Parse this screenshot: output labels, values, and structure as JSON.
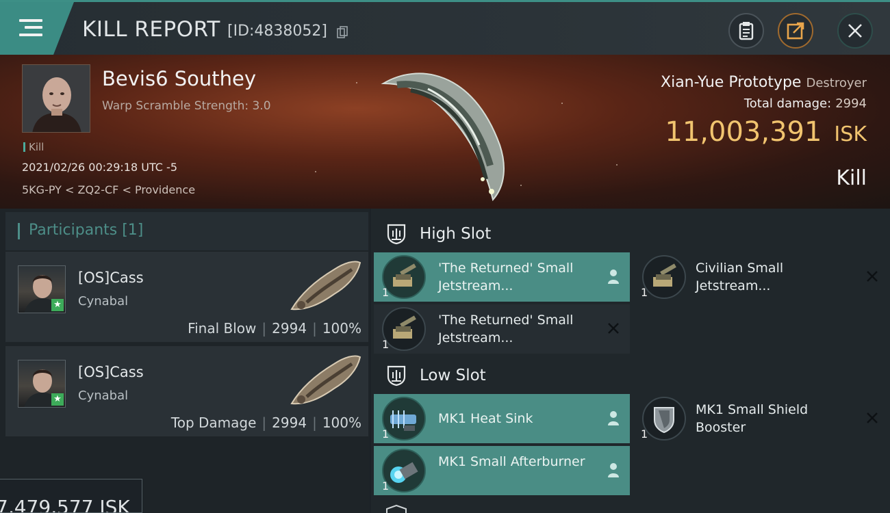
{
  "header": {
    "title": "KILL REPORT",
    "id": "[ID:4838052]",
    "colors": {
      "accent": "#3b8c84",
      "isk": "#f1c46f"
    }
  },
  "victim": {
    "name": "Bevis6 Southey",
    "subline": "Warp Scramble Strength: 3.0",
    "tag": "Kill",
    "datetime": "2021/02/26 00:29:18 UTC -5",
    "location": "5KG-PY < ZQ2-CF < Providence",
    "ship": "Xian-Yue Prototype",
    "ship_class": "Destroyer",
    "total_damage_label": "Total damage:",
    "total_damage": "2994",
    "isk_value": "11,003,391",
    "isk_unit": "ISK",
    "result": "Kill"
  },
  "participants": {
    "header": "Participants [1]",
    "rows": [
      {
        "name": "[OS]Cass",
        "ship": "Cynabal",
        "role": "Final Blow",
        "damage": "2994",
        "percent": "100%"
      },
      {
        "name": "[OS]Cass",
        "ship": "Cynabal",
        "role": "Top Damage",
        "damage": "2994",
        "percent": "100%"
      }
    ]
  },
  "slots": {
    "high": {
      "label": "High Slot",
      "items": [
        {
          "name": "'The Returned' Small Jetstream...",
          "qty": "1",
          "status": "dropped",
          "icon": "turret-icon"
        },
        {
          "name": "Civilian Small Jetstream...",
          "qty": "1",
          "status": "destroyed",
          "icon": "turret-icon"
        },
        {
          "name": "'The Returned' Small Jetstream...",
          "qty": "1",
          "status": "destroyed",
          "icon": "turret-icon"
        }
      ]
    },
    "low": {
      "label": "Low Slot",
      "items": [
        {
          "name": "MK1 Heat Sink",
          "qty": "1",
          "status": "dropped",
          "icon": "heat-sink-icon"
        },
        {
          "name": "MK1 Small Shield Booster",
          "qty": "1",
          "status": "destroyed",
          "icon": "shield-booster-icon"
        },
        {
          "name": "MK1 Small Afterburner",
          "qty": "1",
          "status": "dropped",
          "icon": "afterburner-icon"
        }
      ]
    }
  },
  "footer": {
    "isk_partial": "7,479,577 ISK"
  }
}
